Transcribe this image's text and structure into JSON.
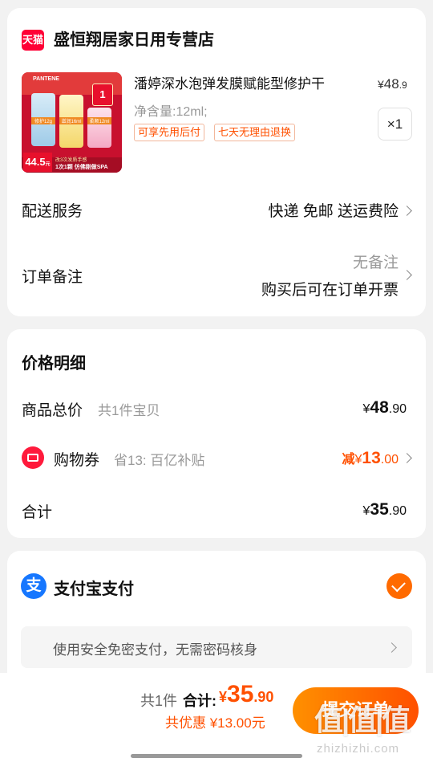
{
  "shop": {
    "badge": "天猫",
    "name": "盛恒翔居家日用专营店"
  },
  "product": {
    "title": "潘婷深水泡弹发膜赋能型修护干",
    "price_symbol": "¥",
    "price_int": "48",
    "price_dec": ".9",
    "spec": "净含量:12ml;",
    "tags": [
      "可享先用后付",
      "七天无理由退换"
    ],
    "quantity": "×1",
    "image": {
      "brand": "PANTENE",
      "promo_price": "44.5",
      "promo_unit": "元",
      "promo_num": "1",
      "bottom_line1": "改3次发质手感",
      "bottom_line2": "1次1颗 仿佛刚做SPA",
      "jar_labels": [
        "修护12g",
        "滋润16ml",
        "柔顺12ml"
      ]
    }
  },
  "delivery": {
    "label": "配送服务",
    "value": "快递 免邮 送运费险"
  },
  "remark": {
    "label": "订单备注",
    "placeholder": "无备注",
    "invoice": "购买后可在订单开票"
  },
  "price_detail": {
    "title": "价格明细",
    "total_label": "商品总价",
    "total_sub": "共1件宝贝",
    "total_sym": "¥",
    "total_int": "48",
    "total_dec": ".90",
    "coupon_label": "购物券",
    "coupon_sub": "省13: 百亿补贴",
    "coupon_prefix": "减",
    "coupon_sym": "¥",
    "coupon_int": "13",
    "coupon_dec": ".00",
    "sum_label": "合计",
    "sum_sym": "¥",
    "sum_int": "35",
    "sum_dec": ".90"
  },
  "payment": {
    "icon_char": "支",
    "label": "支付宝支付",
    "hint": "使用安全免密支付，无需密码核身"
  },
  "bottom": {
    "count": "共1件",
    "total_label": "合计:",
    "total_sym": "¥",
    "total_int": "35",
    "total_dec": ".90",
    "discount": "共优惠 ¥13.00元",
    "submit": "提交订单"
  },
  "watermark": {
    "logo": "值|值|值",
    "url": "zhizhizhi.com"
  },
  "colors": {
    "accent": "#ff5000",
    "alipay": "#1677ff",
    "tmall": "#ff0036"
  }
}
